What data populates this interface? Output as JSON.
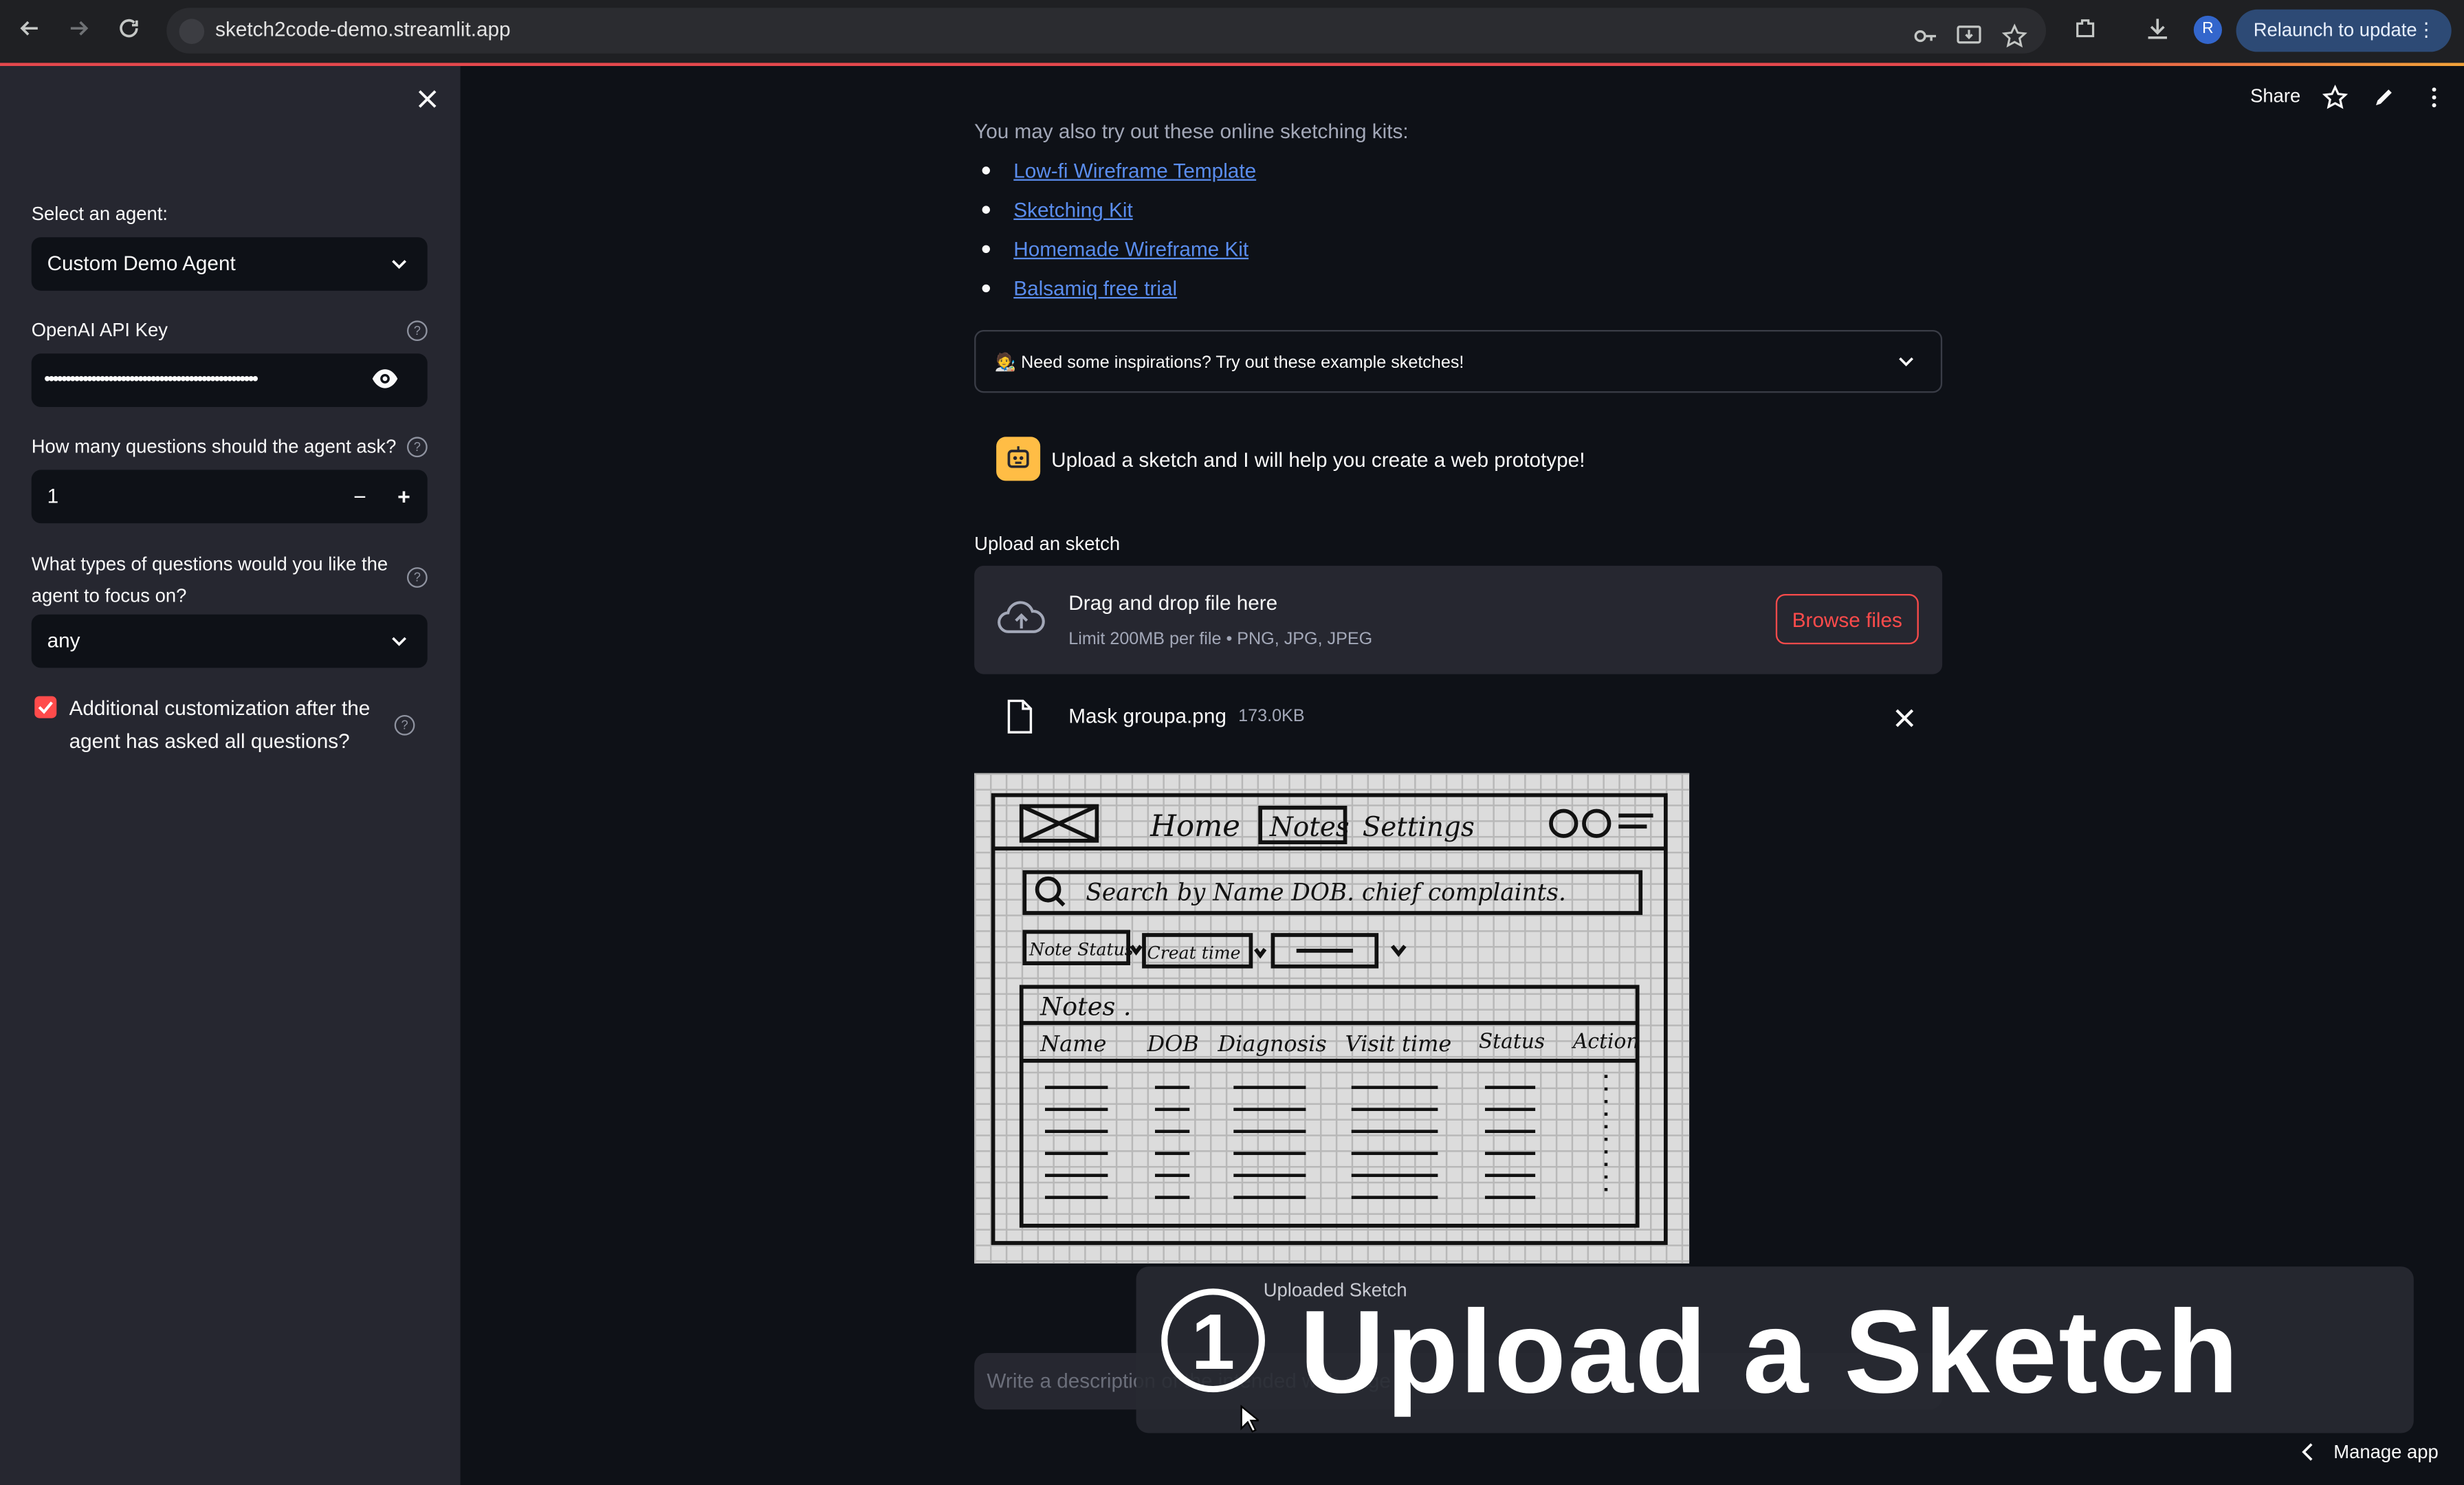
{
  "browser": {
    "url": "sketch2code-demo.streamlit.app",
    "profile_initial": "R",
    "relaunch_label": "Relaunch to update"
  },
  "sidebar": {
    "agent_label": "Select an agent:",
    "agent_value": "Custom Demo Agent",
    "api_key_label": "OpenAI API Key",
    "api_key_value": "••••••••••••••••••••••••••••••••••••••••••••••••••",
    "questions_label": "How many questions should the agent ask?",
    "questions_value": "1",
    "types_label_line1": "What types of questions would you like the",
    "types_label_line2": "agent to focus on?",
    "types_value": "any",
    "custom_checkbox_label": "Additional customization after the agent has asked all questions?",
    "custom_checkbox_checked": true
  },
  "toolbar": {
    "share_label": "Share"
  },
  "main": {
    "intro": "You may also try out these online sketching kits:",
    "links": [
      "Low-fi Wireframe Template",
      "Sketching Kit",
      "Homemade Wireframe Kit",
      "Balsamiq free trial"
    ],
    "expander_label": "🧑‍🎨 Need some inspirations? Try out these example sketches!",
    "bot_message": "Upload a sketch and I will help you create a web prototype!",
    "upload_label": "Upload an sketch",
    "dropzone_title": "Drag and drop file here",
    "dropzone_sub": "Limit 200MB per file • PNG, JPG, JPEG",
    "browse_label": "Browse files",
    "file_name": "Mask groupa.png",
    "file_size": "173.0KB",
    "chat_placeholder": "Write a description of the intended web page",
    "manage_app": "Manage app"
  },
  "sketch": {
    "nav": [
      "Home",
      "Notes",
      "Settings"
    ],
    "search": "Search by Name DOB. chief complaints.",
    "filters": [
      "Note Status",
      "Creat time"
    ],
    "section": "Notes .",
    "columns": [
      "Name",
      "DOB",
      "Diagnosis",
      "Visit time",
      "Status",
      "Action"
    ]
  },
  "overlay": {
    "caption": "Uploaded Sketch",
    "step_number": "1",
    "title": "Upload a Sketch"
  },
  "colors": {
    "accent": "#ff4b4b",
    "link": "#5a8dee",
    "sidebar_bg": "#262730",
    "app_bg": "#0e1117"
  }
}
